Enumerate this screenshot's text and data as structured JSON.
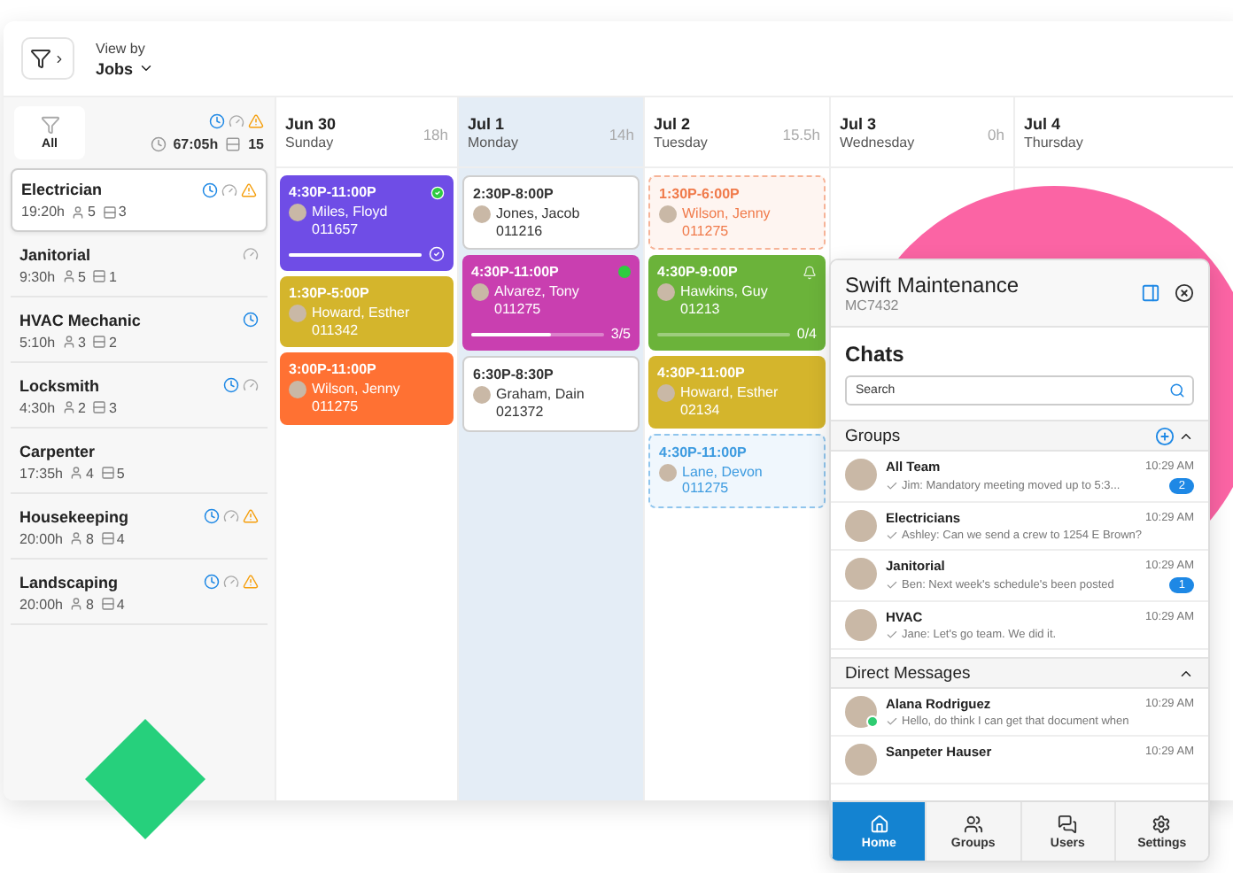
{
  "toolbar": {
    "view_by_label": "View by",
    "view_by_value": "Jobs"
  },
  "summary": {
    "filter_label": "All",
    "hours": "67:05h",
    "count": "15",
    "clock": true,
    "gauge": true,
    "warning": true
  },
  "jobs": [
    {
      "name": "Electrician",
      "hours": "19:20h",
      "people": "5",
      "items": "3",
      "clock": true,
      "gauge": true,
      "warning": true,
      "selected": true
    },
    {
      "name": "Janitorial",
      "hours": "9:30h",
      "people": "5",
      "items": "1",
      "clock": false,
      "gauge": true,
      "warning": false,
      "selected": false
    },
    {
      "name": "HVAC Mechanic",
      "hours": "5:10h",
      "people": "3",
      "items": "2",
      "clock": true,
      "gauge": false,
      "warning": false,
      "selected": false
    },
    {
      "name": "Locksmith",
      "hours": "4:30h",
      "people": "2",
      "items": "3",
      "clock": true,
      "gauge": true,
      "warning": false,
      "selected": false
    },
    {
      "name": "Carpenter",
      "hours": "17:35h",
      "people": "4",
      "items": "5",
      "clock": false,
      "gauge": false,
      "warning": false,
      "selected": false
    },
    {
      "name": "Housekeeping",
      "hours": "20:00h",
      "people": "8",
      "items": "4",
      "clock": true,
      "gauge": true,
      "warning": true,
      "selected": false
    },
    {
      "name": "Landscaping",
      "hours": "20:00h",
      "people": "8",
      "items": "4",
      "clock": true,
      "gauge": true,
      "warning": true,
      "selected": false
    }
  ],
  "days": [
    {
      "date": "Jun 30",
      "weekday": "Sunday",
      "hours": "18h",
      "selected": false,
      "shifts": [
        {
          "kind": "solid",
          "color": "#6f4de6",
          "time": "4:30P-11:00P",
          "name": "Miles, Floyd",
          "code": "011657",
          "done": true,
          "level": 1
        },
        {
          "kind": "solid",
          "color": "#d4b52c",
          "time": "1:30P-5:00P",
          "name": "Howard, Esther",
          "code": "011342"
        },
        {
          "kind": "solid",
          "color": "#ff7133",
          "time": "3:00P-11:00P",
          "name": "Wilson, Jenny",
          "code": "011275"
        }
      ]
    },
    {
      "date": "Jul 1",
      "weekday": "Monday",
      "hours": "14h",
      "selected": true,
      "shifts": [
        {
          "kind": "white",
          "time": "2:30P-8:00P",
          "name": "Jones, Jacob",
          "code": "011216"
        },
        {
          "kind": "solid",
          "color": "#c93fb0",
          "time": "4:30P-11:00P",
          "name": "Alvarez, Tony",
          "code": "011275",
          "live": true,
          "level": 0.6,
          "progress_text": "3/5"
        },
        {
          "kind": "white",
          "time": "6:30P-8:30P",
          "name": "Graham, Dain",
          "code": "021372"
        }
      ]
    },
    {
      "date": "Jul 2",
      "weekday": "Tuesday",
      "hours": "15.5h",
      "selected": false,
      "shifts": [
        {
          "kind": "tentative",
          "color": "#f07a4a",
          "time": "1:30P-6:00P",
          "name": "Wilson, Jenny",
          "code": "011275"
        },
        {
          "kind": "solid",
          "color": "#6bb33a",
          "time": "4:30P-9:00P",
          "name": "Hawkins, Guy",
          "code": "01213",
          "reminder": true,
          "level": 0,
          "progress_text": "0/4"
        },
        {
          "kind": "solid",
          "color": "#d4b52c",
          "time": "4:30P-11:00P",
          "name": "Howard, Esther",
          "code": "02134"
        },
        {
          "kind": "tentative",
          "color": "#3d9be0",
          "time": "4:30P-11:00P",
          "name": "Lane, Devon",
          "code": "011275"
        }
      ]
    },
    {
      "date": "Jul 3",
      "weekday": "Wednesday",
      "hours": "0h",
      "selected": false
    },
    {
      "date": "Jul 4",
      "weekday": "Thursday",
      "selected": false
    }
  ],
  "chat": {
    "title": "Swift Maintenance",
    "code": "MC7432",
    "heading": "Chats",
    "search_placeholder": "Search",
    "sections": [
      {
        "title": "Groups",
        "expanded": true,
        "add": true,
        "items": [
          {
            "name": "All Team",
            "time": "10:29 AM",
            "preview": "Jim: Mandatory meeting moved up  to 5:3...",
            "unread": "2",
            "online": false
          },
          {
            "name": "Electricians",
            "time": "10:29 AM",
            "preview": "Ashley: Can we send a crew to 1254 E Brown?",
            "online": false
          },
          {
            "name": "Janitorial",
            "time": "10:29 AM",
            "preview": "Ben: Next week's schedule's been posted",
            "unread": "1",
            "online": false
          },
          {
            "name": "HVAC",
            "time": "10:29 AM",
            "preview": "Jane: Let's go team. We did it.",
            "online": false
          }
        ]
      },
      {
        "title": "Direct Messages",
        "expanded": true,
        "add": false,
        "items": [
          {
            "name": "Alana Rodriguez",
            "time": "10:29 AM",
            "preview": "Hello, do think I can get that document when",
            "online": true
          },
          {
            "name": "Sanpeter Hauser",
            "time": "10:29 AM",
            "online": false
          }
        ]
      }
    ],
    "nav": [
      {
        "label": "Home",
        "selected": true
      },
      {
        "label": "Groups",
        "selected": false
      },
      {
        "label": "Users",
        "selected": false
      },
      {
        "label": "Settings",
        "selected": false
      }
    ]
  }
}
